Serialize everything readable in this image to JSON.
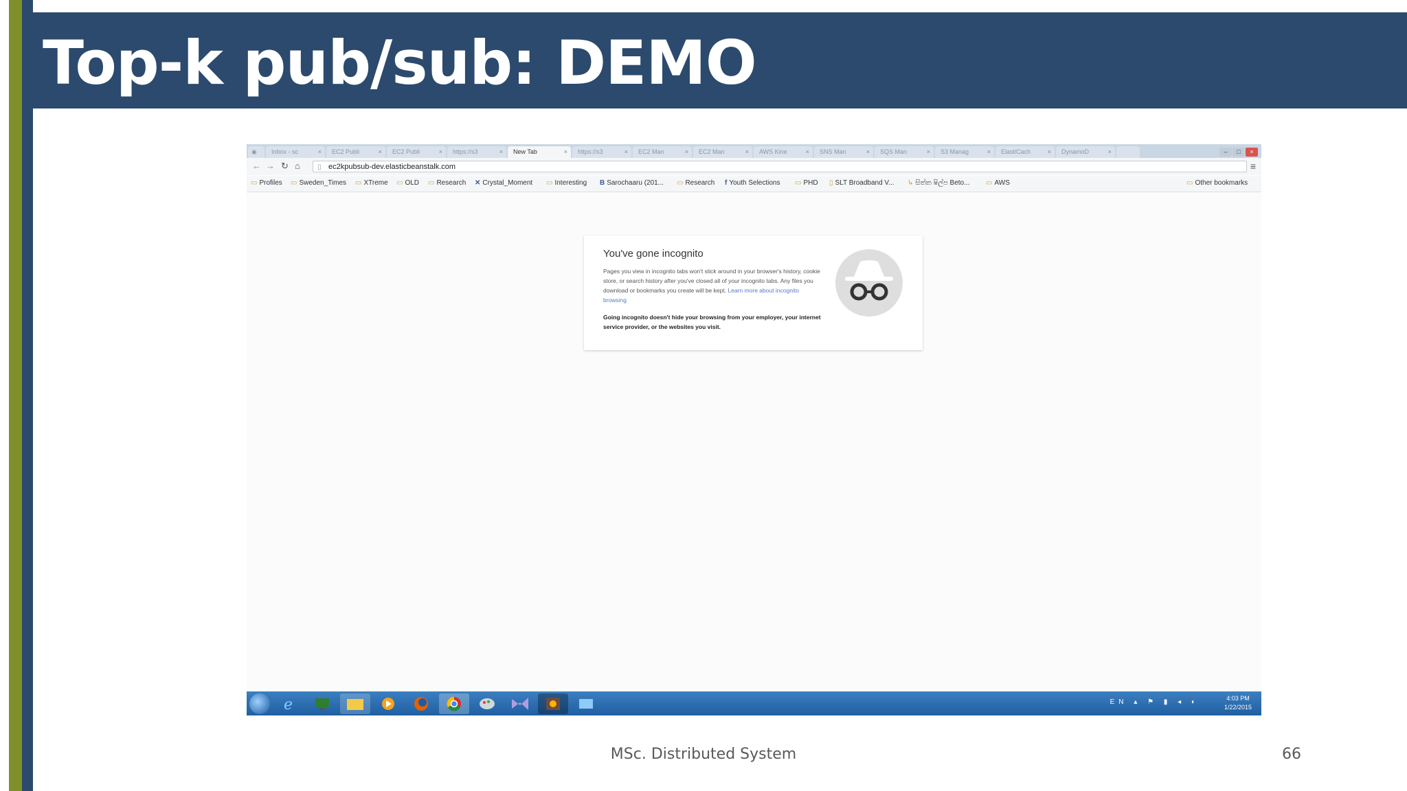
{
  "slide": {
    "title": "Top-k pub/sub: DEMO",
    "footer": "MSc. Distributed System",
    "page_number": "66",
    "colors": {
      "title_band": "#2b4a6d",
      "accent_green": "#7f8f2a"
    }
  },
  "browser": {
    "tabs": [
      {
        "label": "Inbox - sc"
      },
      {
        "label": "EC2 Publi"
      },
      {
        "label": "EC2 Publi"
      },
      {
        "label": "https://s3"
      },
      {
        "label": "New Tab",
        "active": true
      },
      {
        "label": "https://s3"
      },
      {
        "label": "EC2 Man"
      },
      {
        "label": "EC2 Man"
      },
      {
        "label": "AWS Kine"
      },
      {
        "label": "SNS Man"
      },
      {
        "label": "SQS Man"
      },
      {
        "label": "S3 Manag"
      },
      {
        "label": "ElastiCach"
      },
      {
        "label": "DynamoD"
      }
    ],
    "address": "ec2kpubsub-dev.elasticbeanstalk.com",
    "bookmarks": [
      {
        "label": "Profiles",
        "icon": "folder-icon"
      },
      {
        "label": "Sweden_Times",
        "icon": "folder-icon"
      },
      {
        "label": "XTreme",
        "icon": "folder-icon"
      },
      {
        "label": "OLD",
        "icon": "folder-icon"
      },
      {
        "label": "Research",
        "icon": "folder-icon"
      },
      {
        "label": "Crystal_Moment",
        "icon": "x-icon"
      },
      {
        "label": "Interesting",
        "icon": "folder-icon"
      },
      {
        "label": "Sarochaaru (201...",
        "icon": "page-icon"
      },
      {
        "label": "Research",
        "icon": "folder-icon"
      },
      {
        "label": "Youth Selections",
        "icon": "facebook-icon"
      },
      {
        "label": "PHD",
        "icon": "folder-icon"
      },
      {
        "label": "SLT Broadband V...",
        "icon": "page-icon"
      },
      {
        "label": "සිත්ත ෂිල්ප Beto...",
        "icon": "link-icon"
      },
      {
        "label": "AWS",
        "icon": "folder-icon"
      }
    ],
    "other_bookmarks": "Other bookmarks",
    "incognito": {
      "heading": "You've gone incognito",
      "body": "Pages you view in incognito tabs won't stick around in your browser's history, cookie store, or search history after you've closed all of your incognito tabs. Any files you download or bookmarks you create will be kept.",
      "link": "Learn more about incognito browsing",
      "warning": "Going incognito doesn't hide your browsing from your employer, your internet service provider, or the websites you visit."
    }
  },
  "taskbar": {
    "language": "EN",
    "time": "4:03 PM",
    "date": "1/22/2015"
  }
}
